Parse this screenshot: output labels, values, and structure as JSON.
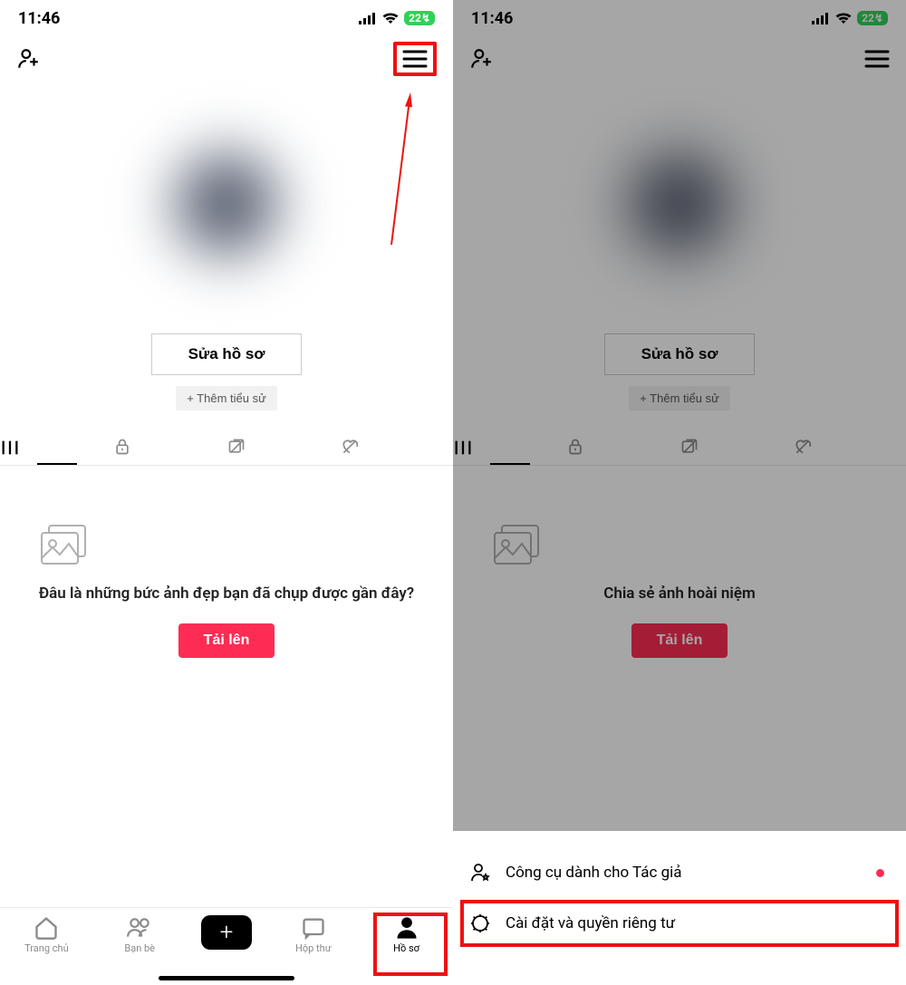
{
  "status": {
    "time": "11:46",
    "battery": "22"
  },
  "profile": {
    "edit_label": "Sửa hồ sơ",
    "bio_label": "+ Thêm tiểu sử"
  },
  "empty_left": {
    "text": "Đâu là những bức ảnh đẹp bạn đã chụp được gần đây?",
    "upload": "Tải lên"
  },
  "empty_right": {
    "text": "Chia sẻ ảnh hoài niệm",
    "upload": "Tải lên"
  },
  "nav": {
    "home": "Trang chủ",
    "friends": "Bạn bè",
    "inbox": "Hộp thư",
    "profile": "Hồ sơ"
  },
  "sheet": {
    "creator": "Công cụ dành cho Tác giả",
    "settings": "Cài đặt và quyền riêng tư"
  }
}
